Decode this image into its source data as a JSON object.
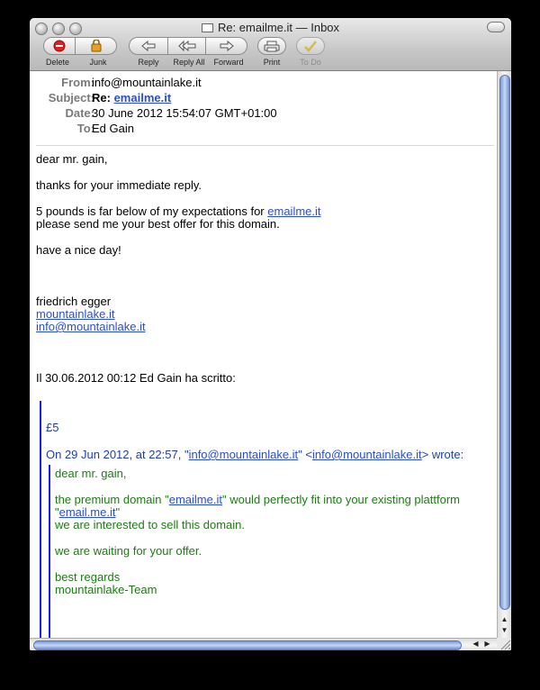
{
  "window": {
    "title": "Re: emailme.it — Inbox"
  },
  "toolbar": {
    "delete": "Delete",
    "junk": "Junk",
    "reply": "Reply",
    "reply_all": "Reply All",
    "forward": "Forward",
    "print": "Print",
    "todo": "To Do"
  },
  "headers": {
    "from_label": "From:",
    "from": "info@mountainlake.it",
    "subject_label": "Subject:",
    "subject_prefix": "Re:",
    "subject_link": "emailme.it",
    "date_label": "Date:",
    "date": "30 June 2012 15:54:07 GMT+01:00",
    "to_label": "To:",
    "to": "Ed Gain"
  },
  "body": {
    "greeting": "dear mr. gain,",
    "thanks": "thanks for your immediate reply.",
    "offer_text": "5 pounds is far below of my expectations for",
    "offer_link": "emailme.it",
    "offer_line2": "please send me your best offer for this domain.",
    "closing": "have a nice day!",
    "sig_name": "friedrich egger",
    "sig_site": "mountainlake.it",
    "sig_email": "info@mountainlake.it",
    "attribution": "Il 30.06.2012 00:12 Ed Gain ha scritto:"
  },
  "quote1": {
    "amount": "£5",
    "attr_prefix": "On 29 Jun 2012, at 22:57, \"",
    "attr_email": "info@mountainlake.it",
    "attr_mid": "\" <",
    "attr_email2": "info@mountainlake.it",
    "attr_suffix": "> wrote:"
  },
  "quote2": {
    "greeting": "dear mr. gain,",
    "l1_prefix": "the premium domain \"",
    "l1_link": "emailme.it",
    "l1_suffix": "\" would perfectly fit into your existing plattform",
    "l2_open": "\"",
    "l2_link": "email.me.it",
    "l2_close": "\"",
    "l3": "we are interested to sell this domain.",
    "l4": "we are waiting for your offer.",
    "l5": "best regards",
    "l6": "mountainlake-Team"
  },
  "colors": {
    "link": "#2b4fcc",
    "quote1_text": "#1f3fa8",
    "quote2_text": "#1f7a16",
    "quote_bar": "#1a1aff"
  }
}
